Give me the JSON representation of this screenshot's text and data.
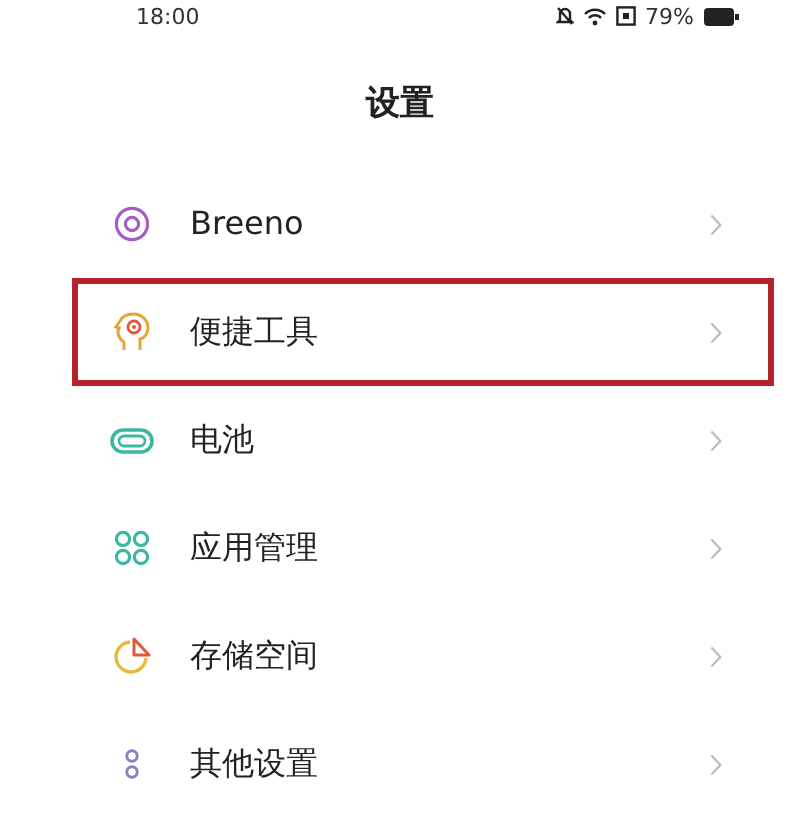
{
  "status_bar": {
    "time": "18:00",
    "battery": "79%"
  },
  "title": "设置",
  "items": [
    {
      "label": "Breeno",
      "kind": "assistant",
      "highlighted": false
    },
    {
      "label": "便捷工具",
      "kind": "tools",
      "highlighted": true
    },
    {
      "label": "电池",
      "kind": "battery",
      "highlighted": false
    },
    {
      "label": "应用管理",
      "kind": "apps",
      "highlighted": false
    },
    {
      "label": "存储空间",
      "kind": "storage",
      "highlighted": false
    },
    {
      "label": "其他设置",
      "kind": "other",
      "highlighted": false
    }
  ]
}
